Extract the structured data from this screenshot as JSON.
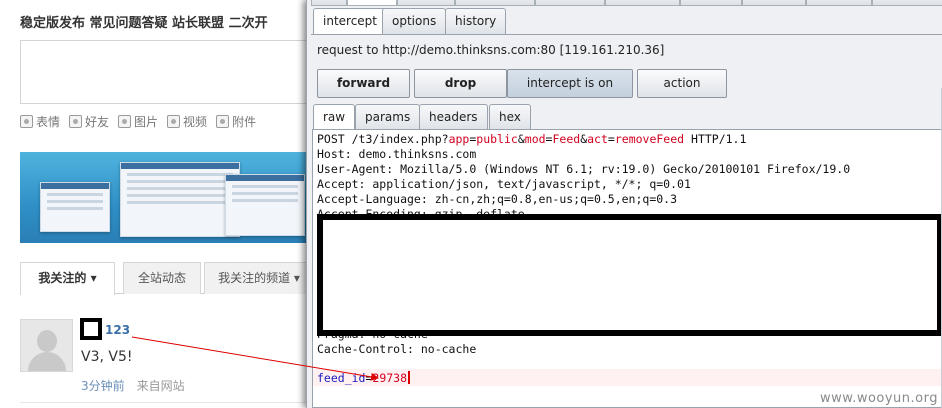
{
  "web": {
    "title": "稳定版发布 常见问题答疑 站长联盟 二次开",
    "tools": [
      {
        "icon": "smile-icon",
        "label": "表情"
      },
      {
        "icon": "at-icon",
        "label": "好友"
      },
      {
        "icon": "image-icon",
        "label": "图片"
      },
      {
        "icon": "video-icon",
        "label": "视频"
      },
      {
        "icon": "attachment-icon",
        "label": "附件"
      }
    ],
    "tabs": [
      "我关注的 ▾",
      "全站动态",
      "我关注的频道 ▾"
    ],
    "feed": {
      "username": "123",
      "text": "V3, V5!",
      "time": "3分钟前",
      "source": "来自网站"
    }
  },
  "burp": {
    "subtabs": [
      "intercept",
      "options",
      "history"
    ],
    "request_info": "request to http://demo.thinksns.com:80  [119.161.210.36]",
    "buttons": {
      "forward": "forward",
      "drop": "drop",
      "intercept": "intercept is on",
      "action": "action"
    },
    "viewtabs": [
      "raw",
      "params",
      "headers",
      "hex"
    ],
    "request": {
      "method": "POST /t3/index.php?",
      "app_key": "app",
      "app_val": "public",
      "mod_key": "mod",
      "mod_val": "Feed",
      "act_key": "act",
      "act_val": "removeFeed",
      "protocol": " HTTP/1.1",
      "host": "Host: demo.thinksns.com",
      "user_agent": "User-Agent: Mozilla/5.0 (Windows NT 6.1; rv:19.0) Gecko/20100101 Firefox/19.0",
      "accept": "Accept: application/json, text/javascript, */*; q=0.01",
      "accept_language": "Accept-Language: zh-cn,zh;q=0.8,en-us;q=0.5,en;q=0.3",
      "accept_encoding": "Accept-Encoding: gzip, deflate",
      "pragma": "Pragma: no-cache",
      "cache_control": "Cache-Control: no-cache",
      "body_key": "feed_id",
      "body_val": "29738"
    }
  },
  "watermark": "www.wooyun.org"
}
